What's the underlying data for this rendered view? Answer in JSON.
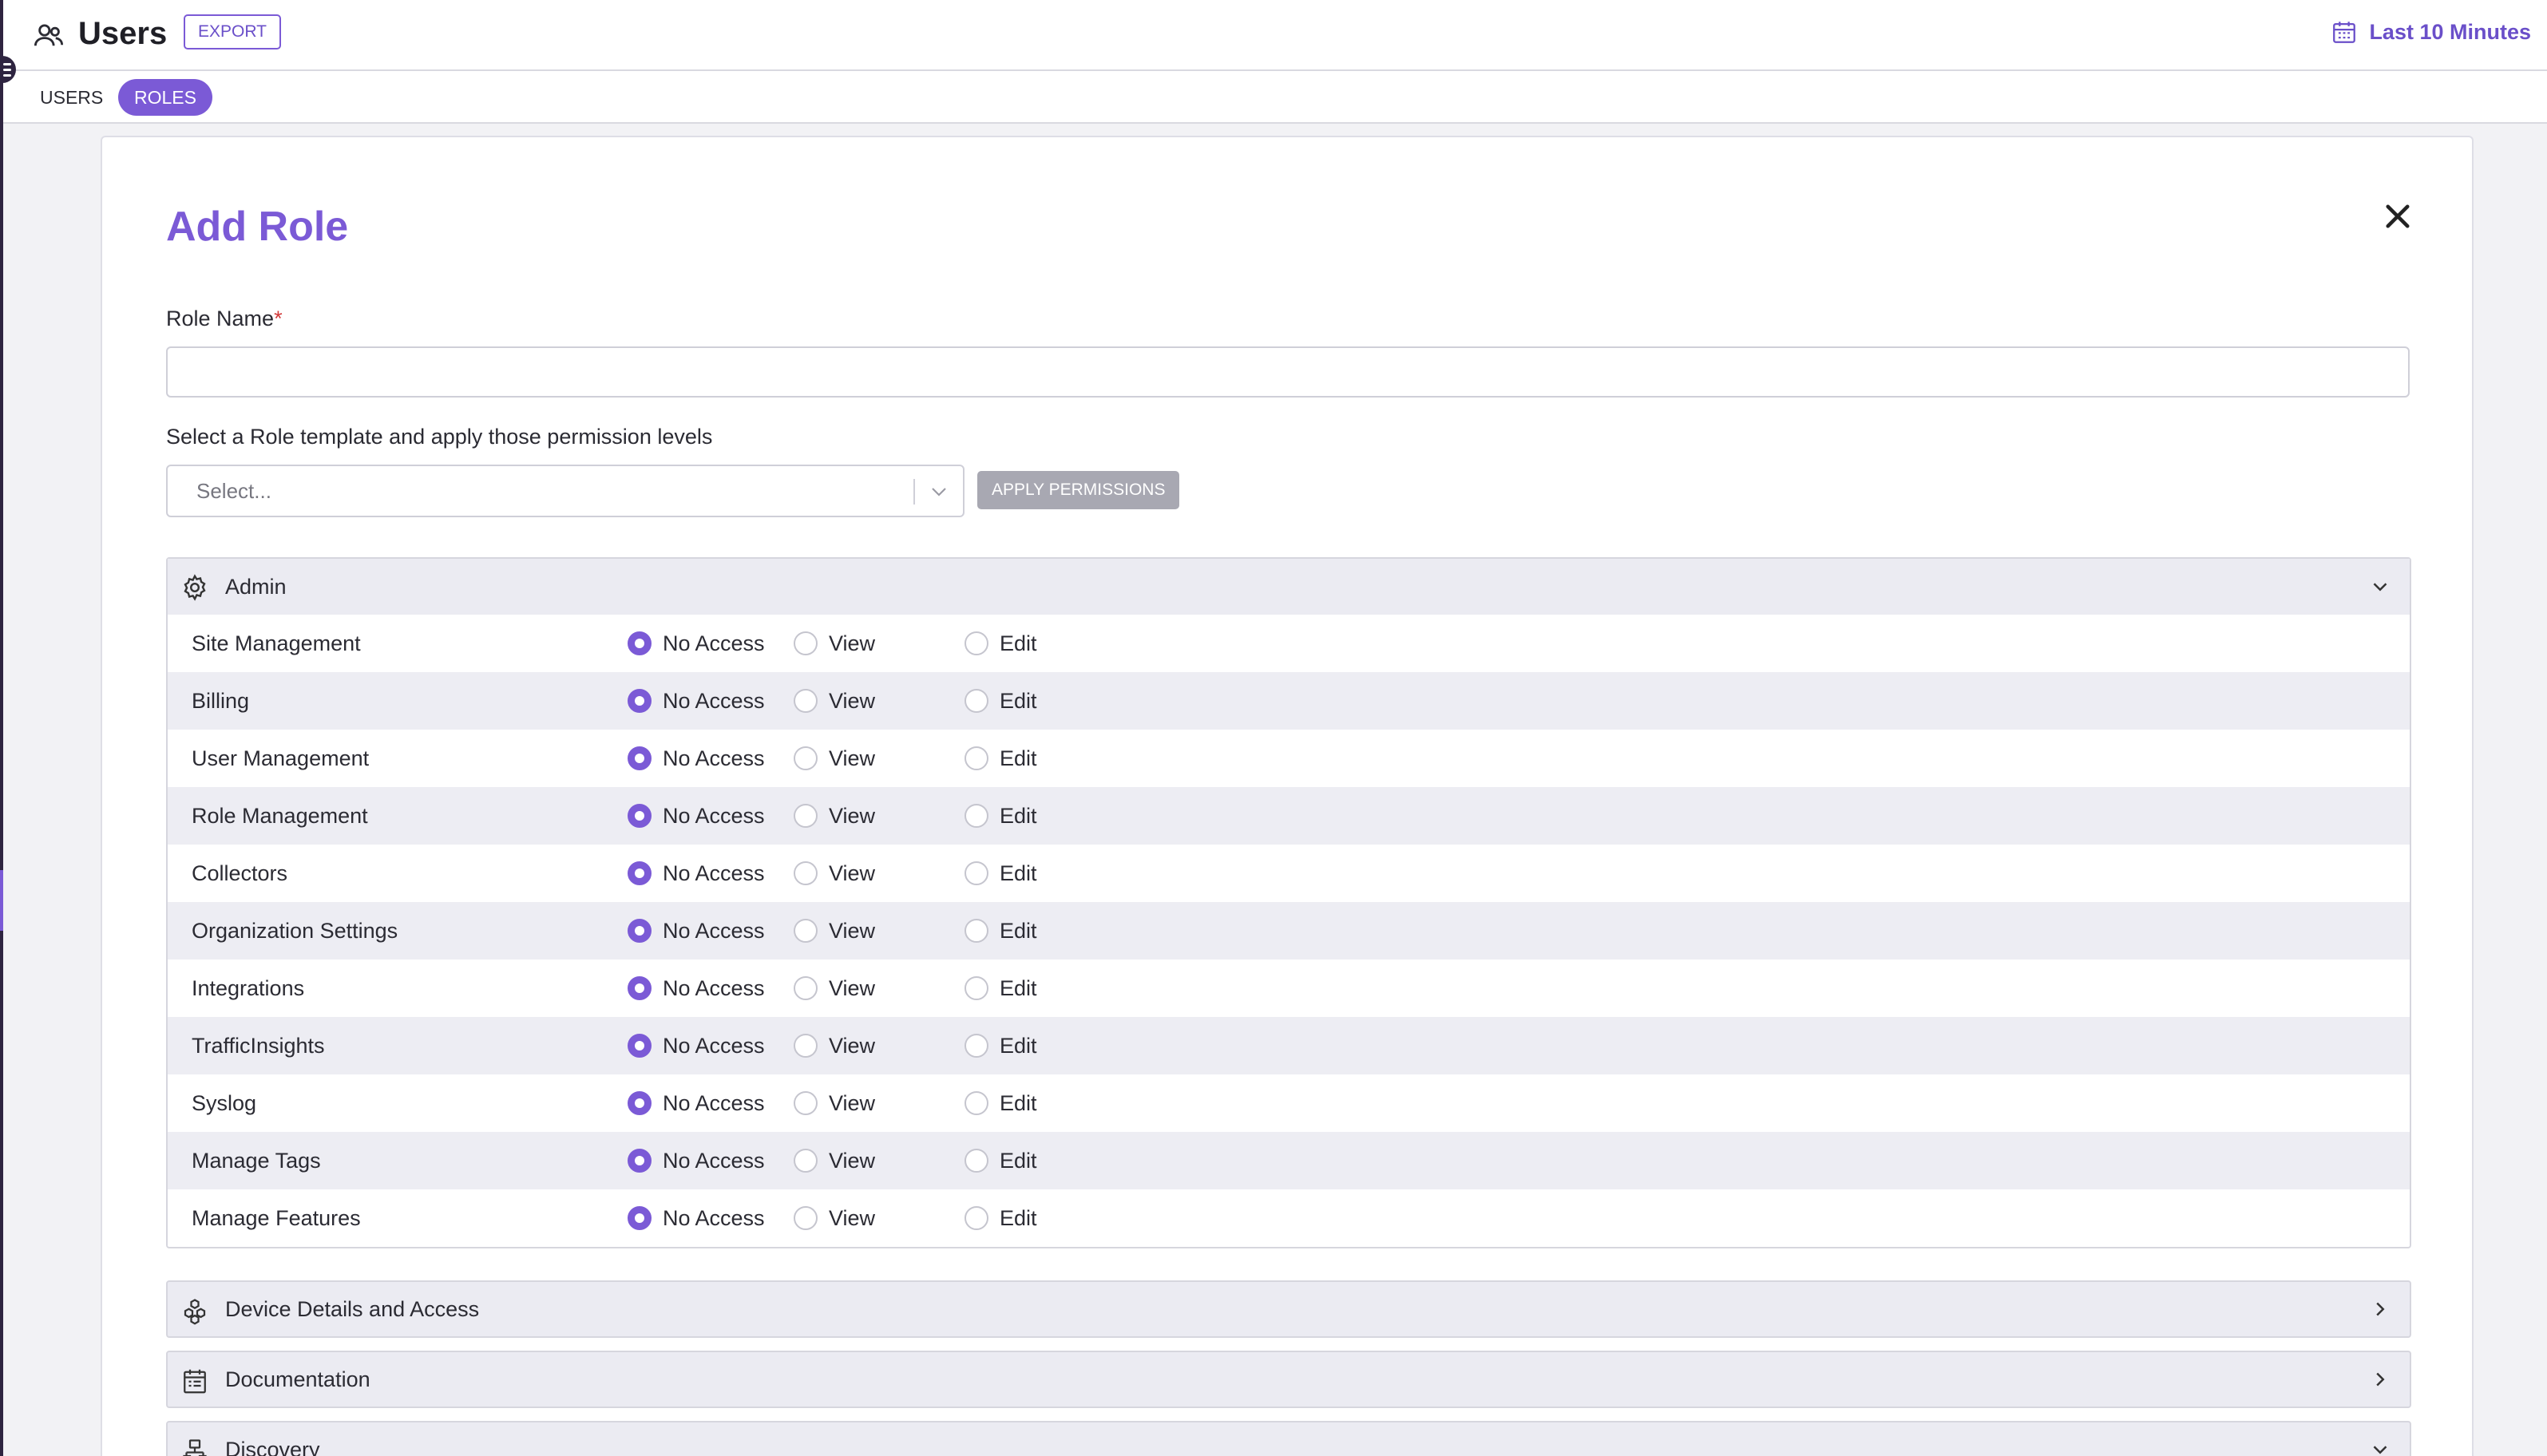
{
  "header": {
    "title": "Users",
    "export_label": "EXPORT",
    "time_range": "Last 10 Minutes"
  },
  "tabs": [
    {
      "label": "USERS",
      "active": false
    },
    {
      "label": "ROLES",
      "active": true
    }
  ],
  "modal": {
    "title": "Add Role",
    "role_name_label": "Role Name",
    "role_name_required_marker": "*",
    "role_name_value": "",
    "template_label": "Select a Role template and apply those permission levels",
    "template_placeholder": "Select...",
    "apply_label": "APPLY PERMISSIONS"
  },
  "permission_options": [
    "No Access",
    "View",
    "Edit"
  ],
  "sections": [
    {
      "title": "Admin",
      "icon": "gear-icon",
      "expanded": true,
      "rows": [
        {
          "name": "Site Management",
          "selected": "No Access"
        },
        {
          "name": "Billing",
          "selected": "No Access"
        },
        {
          "name": "User Management",
          "selected": "No Access"
        },
        {
          "name": "Role Management",
          "selected": "No Access"
        },
        {
          "name": "Collectors",
          "selected": "No Access"
        },
        {
          "name": "Organization Settings",
          "selected": "No Access"
        },
        {
          "name": "Integrations",
          "selected": "No Access"
        },
        {
          "name": "TrafficInsights",
          "selected": "No Access"
        },
        {
          "name": "Syslog",
          "selected": "No Access"
        },
        {
          "name": "Manage Tags",
          "selected": "No Access"
        },
        {
          "name": "Manage Features",
          "selected": "No Access"
        }
      ]
    },
    {
      "title": "Device Details and Access",
      "icon": "devices-icon",
      "expanded": false
    },
    {
      "title": "Documentation",
      "icon": "calendar-list-icon",
      "expanded": false
    },
    {
      "title": "Discovery",
      "icon": "network-icon",
      "expanded": true
    }
  ],
  "colors": {
    "accent": "#7b5ad6",
    "required": "#d23a3a",
    "row_stripe": "#ededf3"
  }
}
